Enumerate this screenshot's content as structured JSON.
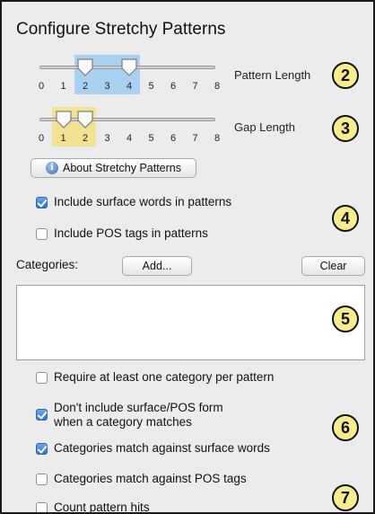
{
  "panel": {
    "title": "Configure Stretchy Patterns"
  },
  "pattern_length": {
    "label": "Pattern Length",
    "min": 0,
    "max": 8,
    "ticks": [
      "0",
      "1",
      "2",
      "3",
      "4",
      "5",
      "6",
      "7",
      "8"
    ],
    "low": 2,
    "high": 4,
    "range_color": "#a9d2f2"
  },
  "gap_length": {
    "label": "Gap Length",
    "min": 0,
    "max": 8,
    "ticks": [
      "0",
      "1",
      "2",
      "3",
      "4",
      "5",
      "6",
      "7",
      "8"
    ],
    "low": 1,
    "high": 2,
    "range_color": "#f3e291"
  },
  "about_button": {
    "label": "About Stretchy Patterns",
    "icon": "info-icon"
  },
  "options": {
    "include_surface_words": {
      "label": "Include surface words in patterns",
      "checked": true
    },
    "include_pos_tags": {
      "label": "Include POS tags in patterns",
      "checked": false
    }
  },
  "categories": {
    "label": "Categories:",
    "add_label": "Add...",
    "clear_label": "Clear",
    "items": []
  },
  "category_options": {
    "require_one": {
      "label": "Require at least one category per pattern",
      "checked": false
    },
    "dont_include_line1": "Don't include surface/POS form",
    "dont_include_line2": "when a category matches",
    "dont_include_checked": true,
    "match_surface": {
      "label": "Categories match against surface words",
      "checked": true
    },
    "match_pos": {
      "label": "Categories match against POS tags",
      "checked": false
    },
    "count_hits": {
      "label": "Count pattern hits",
      "checked": false
    }
  },
  "callouts": [
    "2",
    "3",
    "4",
    "5",
    "6",
    "7"
  ],
  "colors": {
    "callout_fill": "#f7ec8e",
    "checkbox_on": "#2f72cf"
  }
}
